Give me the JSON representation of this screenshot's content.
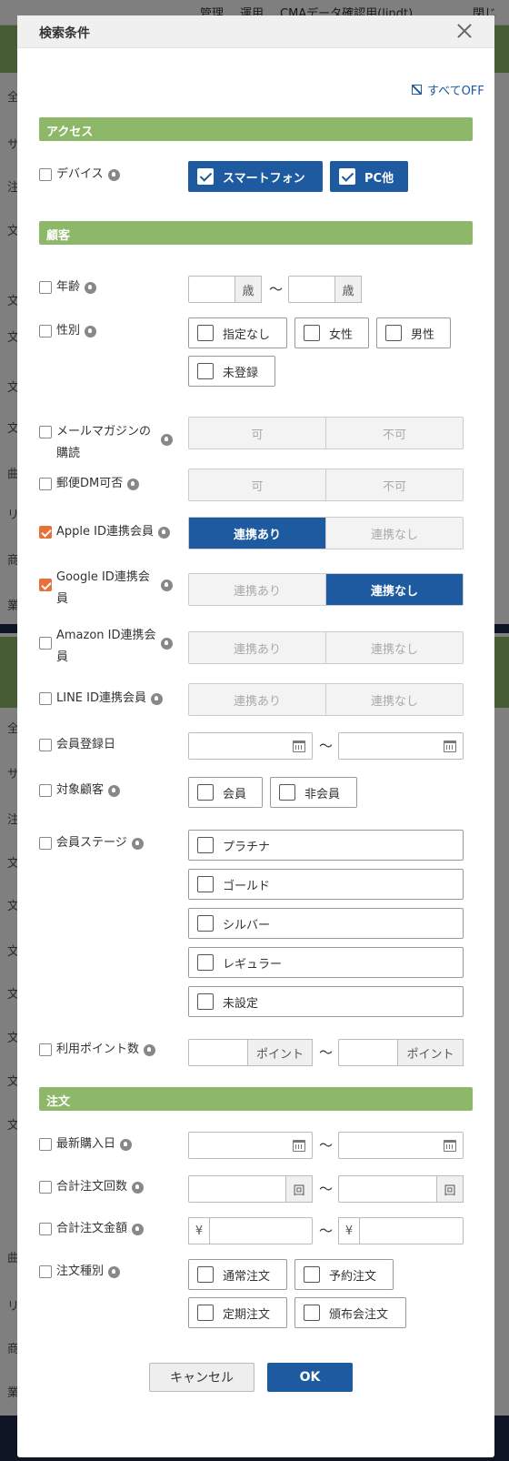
{
  "background": {
    "menu": [
      "管理",
      "運用",
      "CMAデータ確認用(lindt)",
      "閉じ"
    ],
    "row_fragments": [
      "全",
      "サ",
      "注",
      "文",
      "文",
      "文",
      "文",
      "文",
      "曲",
      "リ",
      "商",
      "業",
      "全",
      "サ",
      "注",
      "文",
      "文",
      "文",
      "文",
      "文",
      "文",
      "文",
      "曲",
      "リ",
      "商",
      "業"
    ]
  },
  "modal": {
    "title": "検索条件",
    "all_off": "すべてOFF",
    "sections": {
      "access": "アクセス",
      "customer": "顧客",
      "order": "注文"
    },
    "access": {
      "device": {
        "label": "デバイス",
        "options": [
          {
            "label": "スマートフォン",
            "checked": true
          },
          {
            "label": "PC他",
            "checked": true
          }
        ]
      }
    },
    "customer": {
      "age": {
        "label": "年齢",
        "unit": "歳",
        "from": "",
        "to": ""
      },
      "gender": {
        "label": "性別",
        "options": [
          {
            "label": "指定なし",
            "checked": false
          },
          {
            "label": "女性",
            "checked": false
          },
          {
            "label": "男性",
            "checked": false
          },
          {
            "label": "未登録",
            "checked": false
          }
        ]
      },
      "mail_magazine": {
        "label_line1": "メールマガジンの",
        "label_line2": "購読",
        "options": [
          "可",
          "不可"
        ]
      },
      "postal_dm": {
        "label": "郵便DM可否",
        "options": [
          "可",
          "不可"
        ]
      },
      "apple_id": {
        "label": "Apple ID連携会員",
        "checked": true,
        "options": [
          "連携あり",
          "連携なし"
        ],
        "selected": 0
      },
      "google_id": {
        "label_line1": "Google ID連携会",
        "label_line2": "員",
        "checked": true,
        "options": [
          "連携あり",
          "連携なし"
        ],
        "selected": 1
      },
      "amazon_id": {
        "label_line1": "Amazon ID連携会",
        "label_line2": "員",
        "checked": false,
        "options": [
          "連携あり",
          "連携なし"
        ]
      },
      "line_id": {
        "label": "LINE ID連携会員",
        "checked": false,
        "options": [
          "連携あり",
          "連携なし"
        ]
      },
      "register_date": {
        "label": "会員登録日",
        "from": "",
        "to": ""
      },
      "target": {
        "label": "対象顧客",
        "options": [
          {
            "label": "会員",
            "checked": false
          },
          {
            "label": "非会員",
            "checked": false
          }
        ]
      },
      "stage": {
        "label": "会員ステージ",
        "options": [
          {
            "label": "プラチナ",
            "checked": false
          },
          {
            "label": "ゴールド",
            "checked": false
          },
          {
            "label": "シルバー",
            "checked": false
          },
          {
            "label": "レギュラー",
            "checked": false
          },
          {
            "label": "未設定",
            "checked": false
          }
        ]
      },
      "points": {
        "label": "利用ポイント数",
        "unit": "ポイント",
        "from": "",
        "to": ""
      }
    },
    "order": {
      "last_purchase": {
        "label": "最新購入日",
        "from": "",
        "to": ""
      },
      "total_count": {
        "label": "合計注文回数",
        "unit": "回",
        "from": "",
        "to": ""
      },
      "total_amount": {
        "label": "合計注文金額",
        "currency": "¥",
        "from": "",
        "to": ""
      },
      "order_type": {
        "label": "注文種別",
        "options": [
          {
            "label": "通常注文",
            "checked": false
          },
          {
            "label": "予約注文",
            "checked": false
          },
          {
            "label": "定期注文",
            "checked": false
          },
          {
            "label": "頒布会注文",
            "checked": false
          }
        ]
      }
    },
    "tilde": "～",
    "cancel_label": "キャンセル",
    "ok_label": "OK"
  },
  "colors": {
    "section": "#8db86a",
    "primary": "#1e5aa0",
    "checkbox_on": "#e8713a"
  }
}
